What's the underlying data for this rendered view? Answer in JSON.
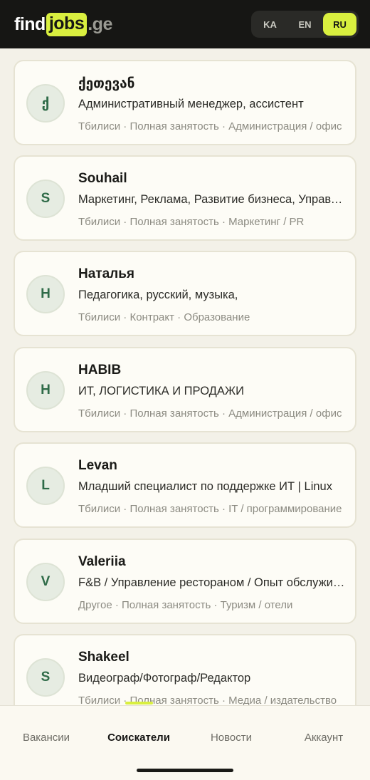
{
  "header": {
    "logo": {
      "part1": "find",
      "part2": "jobs",
      "part3": ".ge"
    },
    "languages": [
      {
        "label": "KA",
        "active": false
      },
      {
        "label": "EN",
        "active": false
      },
      {
        "label": "RU",
        "active": true
      }
    ]
  },
  "candidates": [
    {
      "initial": "ქ",
      "name": "ქეთევან",
      "title": "Административный менеджер, ассистент",
      "meta": "Тбилиси · Полная занятость · Администрация / офис"
    },
    {
      "initial": "S",
      "name": "Souhail",
      "title": "Маркетинг, Реклама, Развитие бизнеса, Управление",
      "meta": "Тбилиси · Полная занятость · Маркетинг / PR"
    },
    {
      "initial": "Н",
      "name": "Наталья",
      "title": "Педагогика, русский, музыка,",
      "meta": "Тбилиси · Контракт · Образование"
    },
    {
      "initial": "H",
      "name": "HABIB",
      "title": "ИТ, ЛОГИСТИКА И ПРОДАЖИ",
      "meta": "Тбилиси · Полная занятость · Администрация / офис"
    },
    {
      "initial": "L",
      "name": "Levan",
      "title": "Младший специалист по поддержке ИТ | Linux",
      "meta": "Тбилиси · Полная занятость · IT / программирование"
    },
    {
      "initial": "V",
      "name": "Valeriia",
      "title": "F&B / Управление рестораном / Опыт обслуживания",
      "meta": "Другое · Полная занятость · Туризм / отели"
    },
    {
      "initial": "S",
      "name": "Shakeel",
      "title": "Видеограф/Фотограф/Редактор",
      "meta": "Тбилиси · Полная занятость · Медиа / издательство"
    }
  ],
  "nav": {
    "items": [
      {
        "label": "Вакансии",
        "active": false
      },
      {
        "label": "Соискатели",
        "active": true
      },
      {
        "label": "Новости",
        "active": false
      },
      {
        "label": "Аккаунт",
        "active": false
      }
    ]
  },
  "colors": {
    "accent": "#d9ef3f",
    "header_bg": "#161614",
    "page_bg": "#f3f1e8"
  }
}
